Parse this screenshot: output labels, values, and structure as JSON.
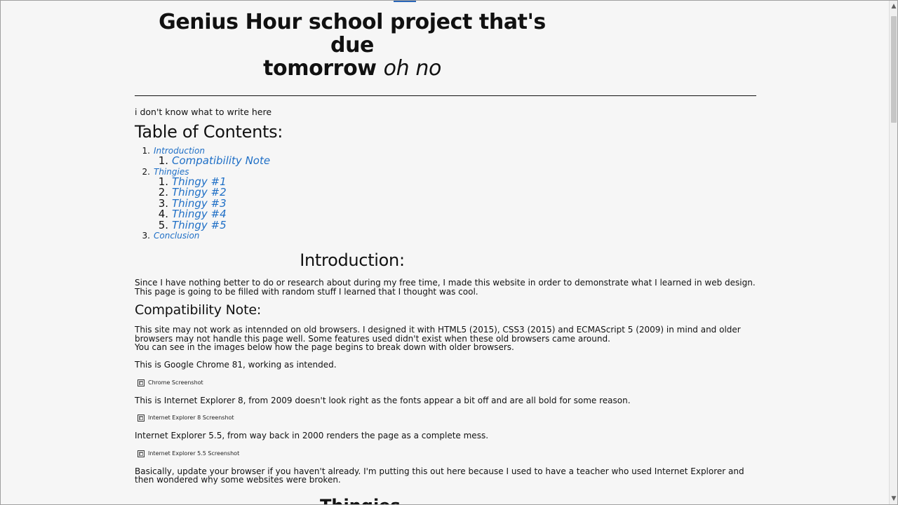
{
  "header": {
    "title_line1": "Genius Hour school project that's due",
    "title_line2": "tomorrow",
    "title_emphasis": "oh no"
  },
  "intro_blurb": "i don't know what to write here",
  "toc": {
    "heading": "Table of Contents:",
    "items": [
      {
        "number": "1.",
        "label": "Introduction",
        "children": [
          {
            "number": "1.",
            "label": "Compatibility Note"
          }
        ]
      },
      {
        "number": "2.",
        "label": "Thingies",
        "children": [
          {
            "number": "1.",
            "label": "Thingy #1"
          },
          {
            "number": "2.",
            "label": "Thingy #2"
          },
          {
            "number": "3.",
            "label": "Thingy #3"
          },
          {
            "number": "4.",
            "label": "Thingy #4"
          },
          {
            "number": "5.",
            "label": "Thingy #5"
          }
        ]
      },
      {
        "number": "3.",
        "label": "Conclusion",
        "children": []
      }
    ]
  },
  "introduction": {
    "heading": "Introduction:",
    "paragraph_line1": "Since I have nothing better to do or research about during my free time, I made this website in order to demonstrate what I learned in web design.",
    "paragraph_line2": "This page is going to be filled with random stuff I learned that I thought was cool."
  },
  "compatibility": {
    "heading": "Compatibility Note:",
    "paragraph_line1": "This site may not work as intennded on old browsers. I designed it with HTML5 (2015), CSS3 (2015) and ECMAScript 5 (2009) in mind and older browsers may not handle this page well. Some features used didn't exist when these old browsers came around.",
    "paragraph_line2": "You can see in the images below how the page begins to break down with older browsers.",
    "chrome_caption": "This is Google Chrome 81, working as intended.",
    "chrome_alt": "Chrome Screenshot",
    "ie8_caption": "This is Internet Explorer 8, from 2009 doesn't look right as the fonts appear a bit off and are all bold for some reason.",
    "ie8_alt": "Internet Explorer 8 Screenshot",
    "ie55_caption": "Internet Explorer 5.5, from way back in 2000 renders the page as a complete mess.",
    "ie55_alt": "Internet Explorer 5.5 Screenshot",
    "closing": "Basically, update your browser if you haven't already. I'm putting this out here because I used to have a teacher who used Internet Explorer and then wondered why some websites were broken."
  },
  "thingies_heading_partial": "Thingies",
  "scrollbar": {
    "up_arrow": "▲",
    "down_arrow": "▼"
  }
}
